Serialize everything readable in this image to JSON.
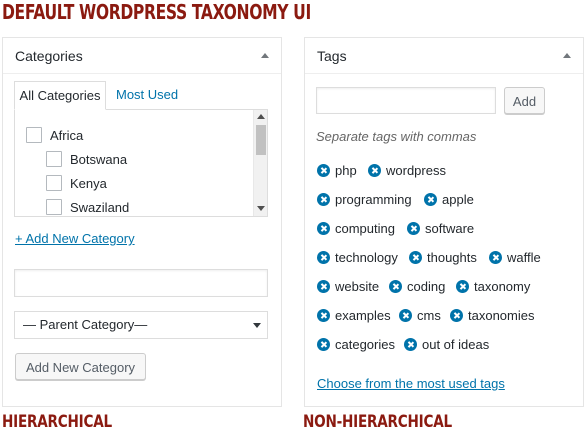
{
  "headline": "DEFAULT WORDPRESS TAXONOMY UI",
  "left_panel": {
    "title": "Categories",
    "tabs": [
      {
        "label": "All Categories"
      },
      {
        "label": "Most Used"
      }
    ],
    "categories": [
      {
        "label": "Africa",
        "checked": false
      },
      {
        "label": "Botswana",
        "checked": false
      },
      {
        "label": "Kenya",
        "checked": false
      },
      {
        "label": "Swaziland",
        "checked": false
      }
    ],
    "add_new_link": "+ Add New Category",
    "new_category_input": {
      "value": "",
      "placeholder": ""
    },
    "parent_select": {
      "selected": "— Parent Category—"
    },
    "add_button": "Add New Category",
    "caption": "HIERARCHICAL"
  },
  "right_panel": {
    "title": "Tags",
    "tag_input": {
      "value": "",
      "placeholder": ""
    },
    "add_button": "Add",
    "hint": "Separate tags with commas",
    "tags": [
      [
        "php",
        "wordpress"
      ],
      [
        "programming",
        "apple"
      ],
      [
        "computing",
        "software"
      ],
      [
        "technology",
        "thoughts",
        "waffle"
      ],
      [
        "website",
        "coding",
        "taxonomy"
      ],
      [
        "examples",
        "cms",
        "taxonomies"
      ],
      [
        "categories",
        "out of ideas"
      ]
    ],
    "choose_link": "Choose from the most used tags",
    "caption": "NON-HIERARCHICAL"
  },
  "colors": {
    "headline": "#8b1a10",
    "link": "#0073aa",
    "tag_remove_icon": "#0073aa",
    "border": "#dddddd"
  }
}
